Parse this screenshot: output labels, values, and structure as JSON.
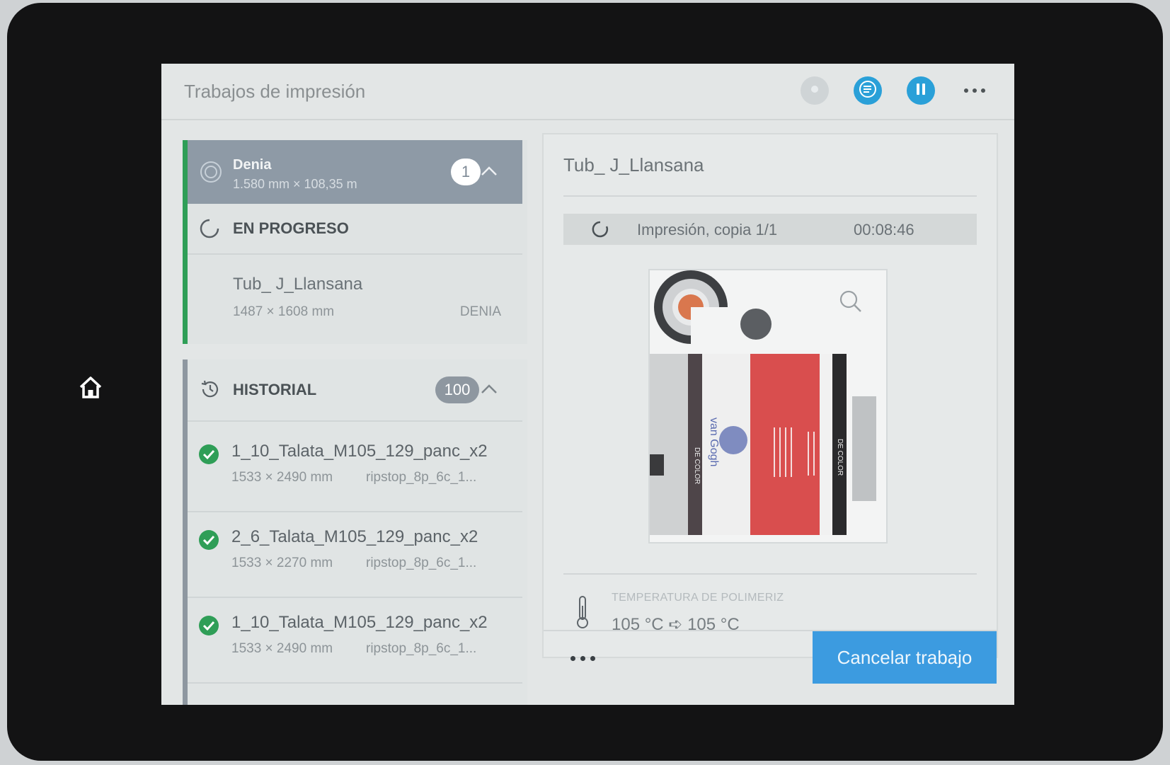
{
  "header": {
    "title": "Trabajos de impresión",
    "buttons": [
      {
        "icon": "disabled-action-icon",
        "state": "disabled"
      },
      {
        "icon": "queue-list-icon",
        "color": "#2aa0d8"
      },
      {
        "icon": "pause-icon",
        "color": "#2aa0d8"
      }
    ],
    "more_icon": "more-horizontal-icon"
  },
  "queue": {
    "name": "Denia",
    "dimensions": "1.580 mm × 108,35 m",
    "count": "1",
    "status_label": "EN PROGRESO",
    "current_job": {
      "name": "Tub_ J_Llansana",
      "dimensions": "1487 × 1608 mm",
      "queue_tag": "DENIA"
    },
    "accent_color": "#2f9e57"
  },
  "history": {
    "label": "HISTORIAL",
    "count": "100",
    "items": [
      {
        "name": "1_10_Talata_M105_129_panc_x2",
        "dimensions": "1533 × 2490 mm",
        "material": "ripstop_8p_6c_1...",
        "status": "completed"
      },
      {
        "name": "2_6_Talata_M105_129_panc_x2",
        "dimensions": "1533 × 2270 mm",
        "material": "ripstop_8p_6c_1...",
        "status": "completed"
      },
      {
        "name": "1_10_Talata_M105_129_panc_x2",
        "dimensions": "1533 × 2490 mm",
        "material": "ripstop_8p_6c_1...",
        "status": "completed"
      }
    ]
  },
  "detail": {
    "job_title": "Tub_ J_Llansana",
    "status_text": "Impresión, copia 1/1",
    "elapsed_time": "00:08:46",
    "preview_texts": {
      "strip_left": "DE COLOR",
      "brand": "van Gogh",
      "strip_right": "DE COLOR"
    },
    "temperature_label": "TEMPERATURA DE POLIMERIZ",
    "temperature_value": "105 °C ➪ 105 °C",
    "cancel_label": "Cancelar trabajo"
  },
  "colors": {
    "accent_blue": "#3c9be0",
    "status_green": "#2f9e57",
    "queue_header": "#8e9aa6"
  }
}
